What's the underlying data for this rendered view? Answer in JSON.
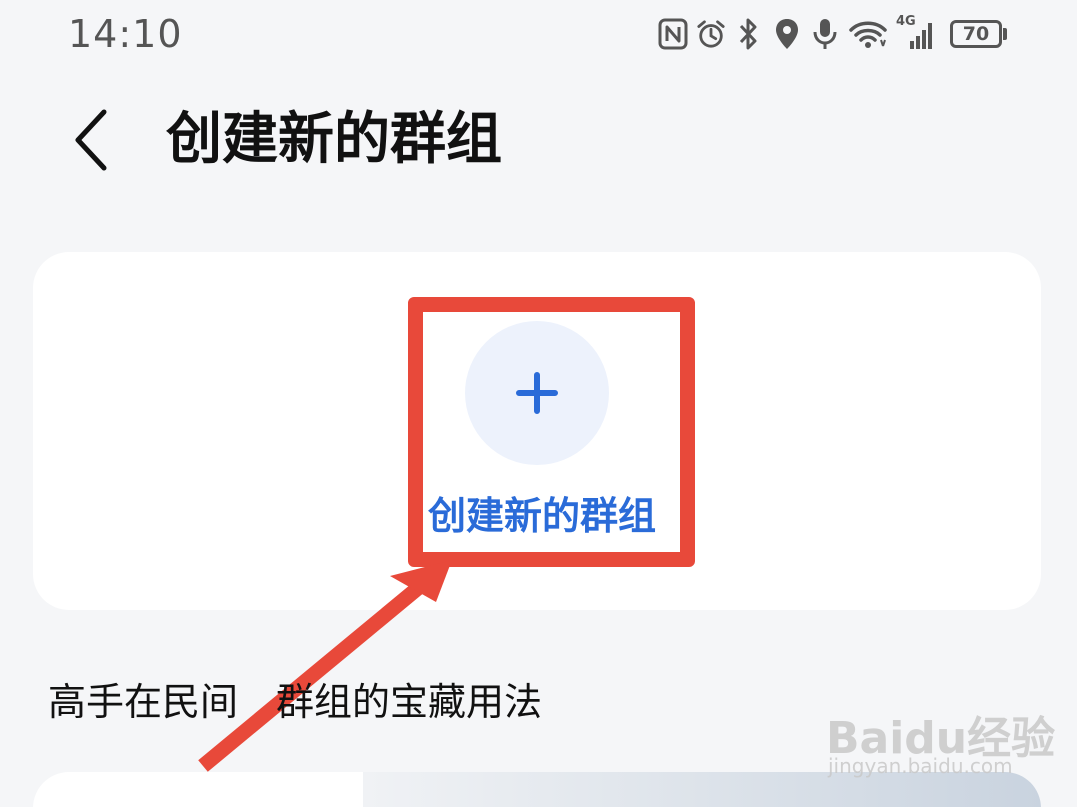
{
  "status_bar": {
    "time": "14:10",
    "icons": [
      "nfc-icon",
      "alarm-icon",
      "bluetooth-icon",
      "location-icon",
      "mic-icon",
      "wifi-icon",
      "4g-signal-icon"
    ],
    "network_label": "4G",
    "battery": "70"
  },
  "header": {
    "back_icon": "chevron-left-icon",
    "title": "创建新的群组"
  },
  "create_card": {
    "icon": "plus-icon",
    "label": "创建新的群组",
    "accent_color": "#2a6bd8",
    "circle_color": "#edf2fc"
  },
  "section": {
    "title": "高手在民间　群组的宝藏用法"
  },
  "annotation": {
    "color": "#e8493a"
  },
  "watermark": {
    "brand": "Baidu经验",
    "url": "jingyan.baidu.com"
  }
}
